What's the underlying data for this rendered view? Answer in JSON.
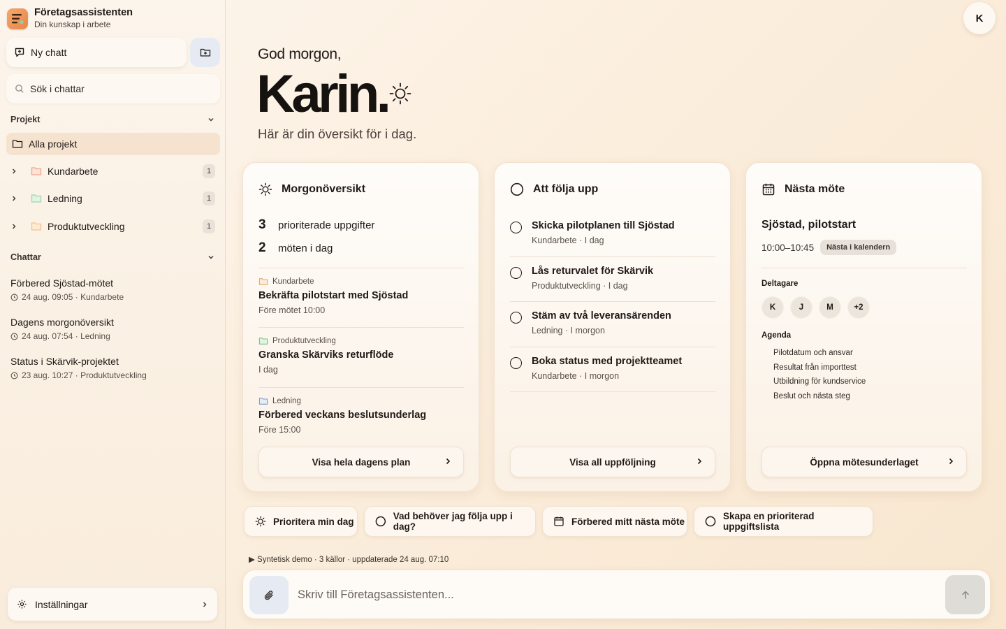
{
  "brand": {
    "title": "Företagsassistenten",
    "subtitle": "Din kunskap i arbete"
  },
  "sidebar": {
    "new_chat_label": "Ny chatt",
    "search_placeholder": "Sök i chattar",
    "projects_heading": "Projekt",
    "all_projects_label": "Alla projekt",
    "projects": [
      {
        "name": "Kundarbete",
        "count": "1",
        "color": "#f2a48a"
      },
      {
        "name": "Ledning",
        "count": "1",
        "color": "#9fd6a3"
      },
      {
        "name": "Produktutveckling",
        "count": "1",
        "color": "#f6c48a"
      }
    ],
    "chats_heading": "Chattar",
    "chats": [
      {
        "title": "Förbered Sjöstad-mötet",
        "meta": "24 aug. 09:05 · Kundarbete"
      },
      {
        "title": "Dagens morgonöversikt",
        "meta": "24 aug. 07:54 · Ledning"
      },
      {
        "title": "Status i Skärvik-projektet",
        "meta": "23 aug. 10:27 · Produktutveckling"
      }
    ],
    "settings_label": "Inställningar"
  },
  "user": {
    "avatar_initial": "K"
  },
  "hero": {
    "greeting": "God morgon,",
    "name": "Karin.",
    "subtitle": "Här är din översikt för i dag."
  },
  "morning": {
    "title": "Morgonöversikt",
    "stats": [
      {
        "num": "3",
        "label": "prioriterade uppgifter"
      },
      {
        "num": "2",
        "label": "möten i dag"
      }
    ],
    "tasks": [
      {
        "project": "Kundarbete",
        "title": "Bekräfta pilotstart med Sjöstad",
        "sub": "Före mötet 10:00"
      },
      {
        "project": "Produktutveckling",
        "title": "Granska Skärviks returflöde",
        "sub": "I dag"
      },
      {
        "project": "Ledning",
        "title": "Förbered veckans beslutsunderlag",
        "sub": "Före 15:00"
      }
    ],
    "button": "Visa hela dagens plan"
  },
  "followup": {
    "title": "Att följa upp",
    "items": [
      {
        "title": "Skicka pilotplanen till Sjöstad",
        "sub": "Kundarbete · I dag"
      },
      {
        "title": "Lås returvalet för Skärvik",
        "sub": "Produktutveckling · I dag"
      },
      {
        "title": "Stäm av två leveransärenden",
        "sub": "Ledning · I morgon"
      },
      {
        "title": "Boka status med projektteamet",
        "sub": "Kundarbete · I morgon"
      }
    ],
    "button": "Visa all uppföljning"
  },
  "meeting": {
    "title": "Nästa möte",
    "name": "Sjöstad, pilotstart",
    "time": "10:00–10:45",
    "badge": "Nästa i kalendern",
    "participants_heading": "Deltagare",
    "participants": [
      "K",
      "J",
      "M",
      "+2"
    ],
    "agenda_heading": "Agenda",
    "agenda": [
      "Pilotdatum och ansvar",
      "Resultat från importtest",
      "Utbildning för kundservice",
      "Beslut och nästa steg"
    ],
    "button": "Öppna mötesunderlaget"
  },
  "chips": [
    {
      "label": "Prioritera min dag",
      "icon": "sun-icon"
    },
    {
      "label": "Vad behöver jag följa upp i dag?",
      "icon": "circle-icon"
    },
    {
      "label": "Förbered mitt nästa möte",
      "icon": "calendar-icon"
    },
    {
      "label": "Skapa en prioriterad uppgiftslista",
      "icon": "circle-icon"
    }
  ],
  "sources_line": "▶ Syntetisk demo · 3 källor · uppdaterade 24 aug. 07:10",
  "composer": {
    "placeholder": "Skriv till Företagsassistenten..."
  }
}
